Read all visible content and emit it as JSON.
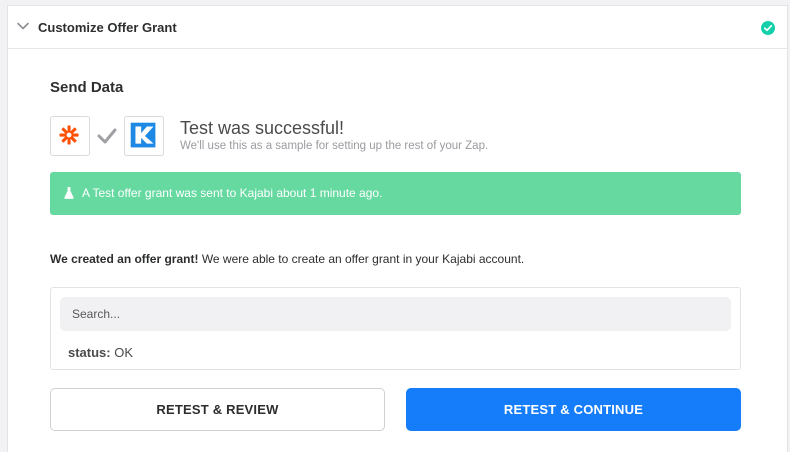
{
  "header": {
    "title": "Customize Offer Grant",
    "collapse_icon": "chevron-down-icon",
    "status_icon": "check-circle-icon",
    "status_color": "#13d0ab"
  },
  "section": {
    "title": "Send Data"
  },
  "test_result": {
    "source_app_icon": "zapier-icon",
    "target_app_icon": "kajabi-icon",
    "connector_icon": "checkmark-icon",
    "title": "Test was successful!",
    "subtitle": "We'll use this as a sample for setting up the rest of your Zap."
  },
  "alert": {
    "icon": "flask-icon",
    "text": "A Test offer grant was sent to Kajabi about 1 minute ago.",
    "color": "#66d9a1"
  },
  "result": {
    "bold": "We created an offer grant!",
    "text": " We were able to create an offer grant in your Kajabi account."
  },
  "data_box": {
    "search_placeholder": "Search...",
    "fields": [
      {
        "key": "status:",
        "value": "OK"
      }
    ]
  },
  "buttons": {
    "retest_review": "RETEST & REVIEW",
    "retest_continue": "RETEST & CONTINUE",
    "primary_color": "#157dfa"
  }
}
